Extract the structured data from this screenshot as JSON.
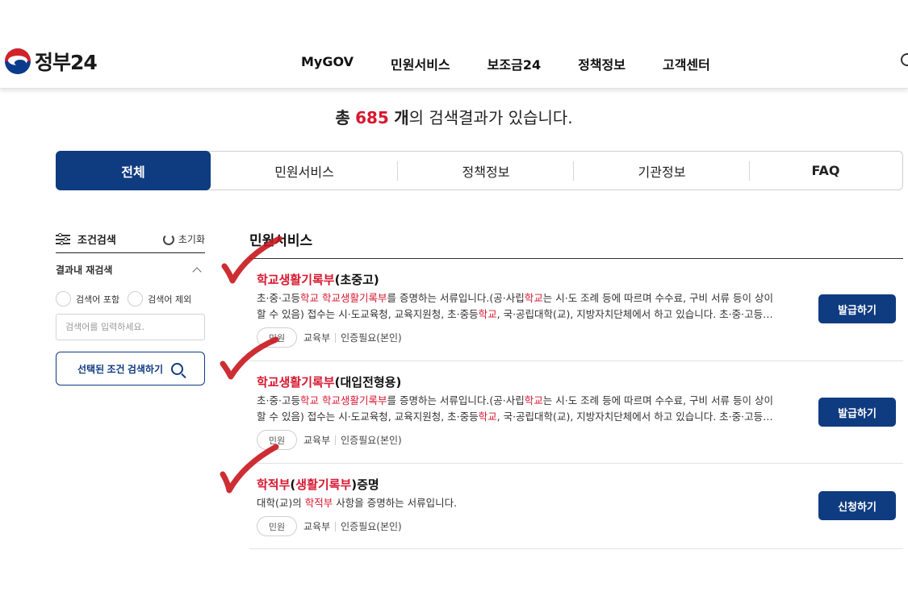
{
  "header": {
    "logo_text": "정부24",
    "nav": [
      "MyGOV",
      "민원서비스",
      "보조금24",
      "정책정보",
      "고객센터"
    ]
  },
  "summary": {
    "prefix": "총",
    "count": "685",
    "unit": "개",
    "suffix": "의 검색결과가 있습니다."
  },
  "tabs": [
    "전체",
    "민원서비스",
    "정책정보",
    "기관정보",
    "FAQ"
  ],
  "filter": {
    "title": "조건검색",
    "reset_label": "초기화",
    "subsection": "결과내 재검색",
    "include_label": "검색어 포함",
    "exclude_label": "검색어 제외",
    "input_placeholder": "검색어를 입력하세요.",
    "search_button": "선택된 조건 검색하기"
  },
  "section_title": "민원서비스",
  "results": [
    {
      "title_hl": "학교생활기록부",
      "title_rest": "(초중고)",
      "desc_line1": [
        "초·중·고등",
        "학교",
        " ",
        "학교생활기록부",
        "를 증명하는 서류입니다.(공·사립",
        "학교",
        "는 시·도 조례 등에 따르며 수수료, 구비 서류 등이 상이"
      ],
      "desc_line2": [
        "할 수 있음) 접수는 시·도교육청, 교육지원청, 초·중등",
        "학교",
        ", 국·공립대학(교), 지방자치단체에서 하고 있습니다. 초·중·고등…"
      ],
      "badge": "민원",
      "agency": "교육부",
      "auth": "인증필요(본인)",
      "button": "발급하기"
    },
    {
      "title_hl": "학교생활기록부",
      "title_rest": "(대입전형용)",
      "desc_line1": [
        "초·중·고등",
        "학교",
        " ",
        "학교생활기록부",
        "를 증명하는 서류입니다.(공·사립",
        "학교",
        "는 시·도 조례 등에 따르며 수수료, 구비 서류 등이 상이"
      ],
      "desc_line2": [
        "할 수 있음) 접수는 시·도교육청, 교육지원청, 초·중등",
        "학교",
        ", 국·공립대학(교), 지방자치단체에서 하고 있습니다. 초·중·고등…"
      ],
      "badge": "민원",
      "agency": "교육부",
      "auth": "인증필요(본인)",
      "button": "발급하기"
    },
    {
      "title_hl1": "학적부",
      "title_mid1": "(",
      "title_hl2": "생활기록부",
      "title_mid2": ")증명",
      "desc": [
        "대학(교)의 ",
        "학적부",
        " 사항을 증명하는 서류입니다."
      ],
      "badge": "민원",
      "agency": "교육부",
      "auth": "인증필요(본인)",
      "button": "신청하기"
    }
  ],
  "colors": {
    "primary": "#0f3b80",
    "highlight": "#d7172f",
    "check_mark": "#c8171d"
  }
}
